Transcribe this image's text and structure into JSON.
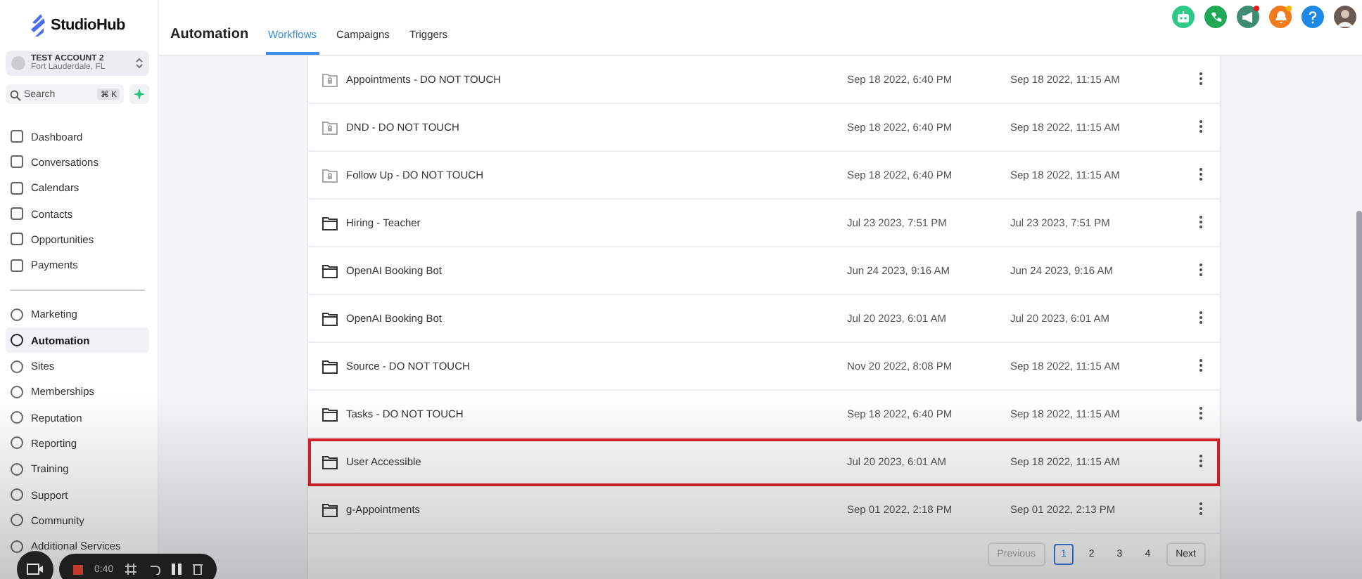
{
  "logo": {
    "name": "StudioHub"
  },
  "account": {
    "name": "TEST ACCOUNT 2",
    "location": "Fort Lauderdale, FL"
  },
  "search": {
    "placeholder": "Search",
    "shortcut": "⌘ K"
  },
  "nav_primary": [
    {
      "label": "Dashboard",
      "selected": false
    },
    {
      "label": "Conversations",
      "selected": false
    },
    {
      "label": "Calendars",
      "selected": false
    },
    {
      "label": "Contacts",
      "selected": false
    },
    {
      "label": "Opportunities",
      "selected": false
    },
    {
      "label": "Payments",
      "selected": false
    }
  ],
  "nav_secondary": [
    {
      "label": "Marketing",
      "selected": false
    },
    {
      "label": "Automation",
      "selected": true
    },
    {
      "label": "Sites",
      "selected": false
    },
    {
      "label": "Memberships",
      "selected": false
    },
    {
      "label": "Reputation",
      "selected": false
    },
    {
      "label": "Reporting",
      "selected": false
    },
    {
      "label": "Training",
      "selected": false
    },
    {
      "label": "Support",
      "selected": false
    },
    {
      "label": "Community",
      "selected": false
    },
    {
      "label": "Additional Services",
      "selected": false
    }
  ],
  "header": {
    "title": "Automation",
    "tabs": [
      {
        "label": "Workflows",
        "selected": true
      },
      {
        "label": "Campaigns",
        "selected": false
      },
      {
        "label": "Triggers",
        "selected": false
      }
    ],
    "notifications": [
      {
        "kind": "robot",
        "color": "#2ec98a",
        "badge": false
      },
      {
        "kind": "phone",
        "color": "#1fa855",
        "badge": false
      },
      {
        "kind": "megaphone",
        "color": "#3d8c73",
        "badge": true
      },
      {
        "kind": "bell",
        "color": "#f47a1e",
        "badge": true
      },
      {
        "kind": "help",
        "color": "#1e88e5",
        "badge": false
      },
      {
        "kind": "avatar",
        "color": "#6b5a52",
        "badge": false
      }
    ]
  },
  "workflows": [
    {
      "kind": "locked-folder",
      "name": "Appointments - DO NOT TOUCH",
      "created": "Sep 18 2022, 6:40 PM",
      "updated": "Sep 18 2022, 11:15 AM",
      "highlighted": false
    },
    {
      "kind": "locked-folder",
      "name": "DND - DO NOT TOUCH",
      "created": "Sep 18 2022, 6:40 PM",
      "updated": "Sep 18 2022, 11:15 AM",
      "highlighted": false
    },
    {
      "kind": "locked-folder",
      "name": "Follow Up - DO NOT TOUCH",
      "created": "Sep 18 2022, 6:40 PM",
      "updated": "Sep 18 2022, 11:15 AM",
      "highlighted": false
    },
    {
      "kind": "folder",
      "name": "Hiring - Teacher",
      "created": "Jul 23 2023, 7:51 PM",
      "updated": "Jul 23 2023, 7:51 PM",
      "highlighted": false
    },
    {
      "kind": "folder",
      "name": "OpenAI Booking Bot",
      "created": "Jun 24 2023, 9:16 AM",
      "updated": "Jun 24 2023, 9:16 AM",
      "highlighted": false
    },
    {
      "kind": "folder",
      "name": "OpenAI Booking Bot",
      "created": "Jul 20 2023, 6:01 AM",
      "updated": "Jul 20 2023, 6:01 AM",
      "highlighted": false
    },
    {
      "kind": "folder",
      "name": "Source - DO NOT TOUCH",
      "created": "Nov 20 2022, 8:08 PM",
      "updated": "Sep 18 2022, 11:15 AM",
      "highlighted": false
    },
    {
      "kind": "folder",
      "name": "Tasks - DO NOT TOUCH",
      "created": "Sep 18 2022, 6:40 PM",
      "updated": "Sep 18 2022, 11:15 AM",
      "highlighted": false
    },
    {
      "kind": "folder",
      "name": "User Accessible",
      "created": "Jul 20 2023, 6:01 AM",
      "updated": "Sep 18 2022, 11:15 AM",
      "highlighted": true
    },
    {
      "kind": "folder",
      "name": "g-Appointments",
      "created": "Sep 01 2022, 2:18 PM",
      "updated": "Sep 01 2022, 2:13 PM",
      "highlighted": false
    }
  ],
  "pagination": {
    "previous": "Previous",
    "pages": [
      {
        "label": "1",
        "selected": true
      },
      {
        "label": "2",
        "selected": false
      },
      {
        "label": "3",
        "selected": false
      },
      {
        "label": "4",
        "selected": false
      }
    ],
    "next": "Next"
  },
  "recorder": {
    "time": "0:40"
  }
}
